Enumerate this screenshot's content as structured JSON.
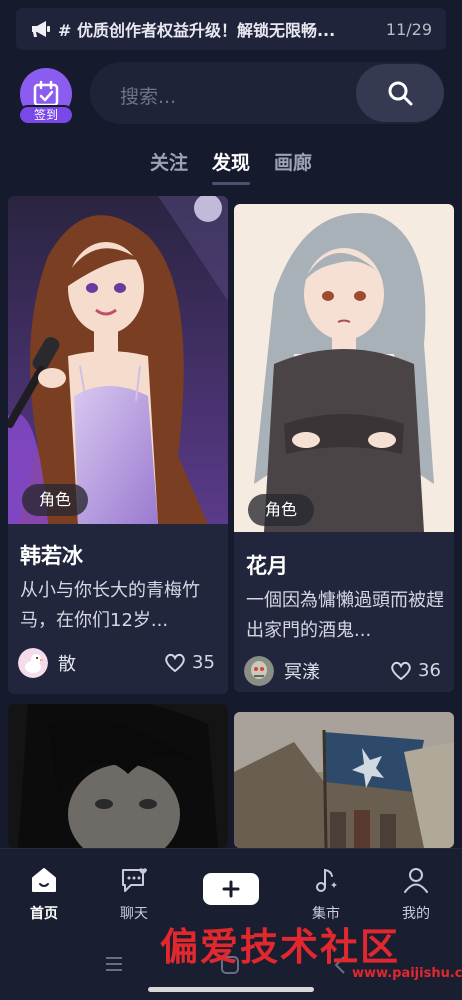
{
  "notice": {
    "text": "# 优质创作者权益升级！解锁无限畅...",
    "counter": "11/29"
  },
  "checkin": {
    "label": "签到"
  },
  "search": {
    "placeholder": "搜索..."
  },
  "tabs": [
    {
      "label": "关注",
      "active": false
    },
    {
      "label": "发现",
      "active": true
    },
    {
      "label": "画廊",
      "active": false
    }
  ],
  "cards": [
    {
      "tag": "角色",
      "name": "韩若冰",
      "desc": "从小与你长大的青梅竹马，在你们12岁...",
      "author": "散",
      "likes": "35"
    },
    {
      "tag": "角色",
      "name": "花月",
      "desc": "一個因為慵懶過頭而被趕出家門的酒鬼...",
      "author": "冥漾",
      "likes": "36"
    }
  ],
  "nav": {
    "home": "首页",
    "chat": "聊天",
    "market": "集市",
    "me": "我的"
  },
  "watermark": {
    "title": "偏爱技术社区",
    "url": "www.paijishu.com"
  },
  "colors": {
    "background": "#161a2d",
    "accent": "#8a5cf0",
    "card": "#22263c"
  }
}
